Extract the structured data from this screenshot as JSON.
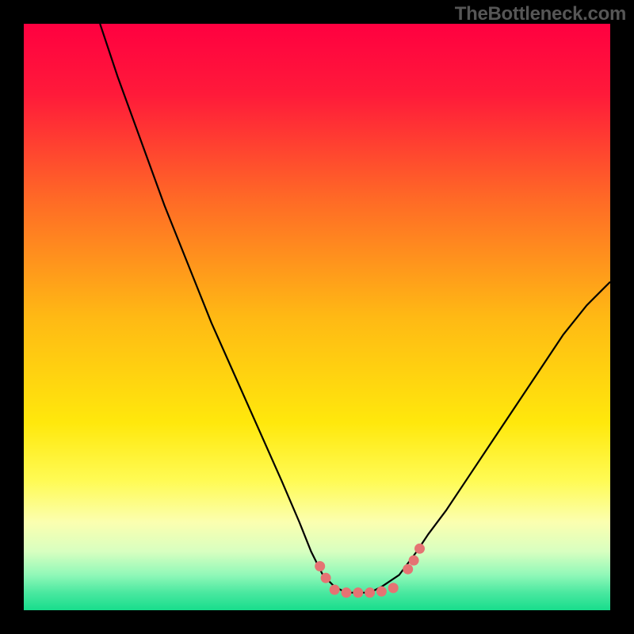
{
  "watermark": "TheBottleneck.com",
  "chart_data": {
    "type": "line",
    "title": "",
    "xlabel": "",
    "ylabel": "",
    "xlim": [
      0,
      100
    ],
    "ylim": [
      0,
      100
    ],
    "gradient_stops": [
      {
        "pos": 0.0,
        "color": "#ff0040"
      },
      {
        "pos": 0.12,
        "color": "#ff1a3a"
      },
      {
        "pos": 0.3,
        "color": "#ff6a26"
      },
      {
        "pos": 0.5,
        "color": "#ffb914"
      },
      {
        "pos": 0.68,
        "color": "#ffe80c"
      },
      {
        "pos": 0.78,
        "color": "#fffb55"
      },
      {
        "pos": 0.85,
        "color": "#fbffb0"
      },
      {
        "pos": 0.9,
        "color": "#d8ffc0"
      },
      {
        "pos": 0.94,
        "color": "#90f8b8"
      },
      {
        "pos": 0.97,
        "color": "#4ae8a0"
      },
      {
        "pos": 1.0,
        "color": "#18dd8c"
      }
    ],
    "series": [
      {
        "name": "bottleneck-curve",
        "x": [
          13,
          16,
          20,
          24,
          28,
          32,
          36,
          40,
          44,
          47,
          49,
          51,
          53,
          55,
          57,
          59,
          61,
          64,
          67,
          69,
          72,
          76,
          80,
          84,
          88,
          92,
          96,
          100
        ],
        "y": [
          100,
          91,
          80,
          69,
          59,
          49,
          40,
          31,
          22,
          15,
          10,
          6,
          4,
          3,
          3,
          3,
          4,
          6,
          10,
          13,
          17,
          23,
          29,
          35,
          41,
          47,
          52,
          56
        ]
      }
    ],
    "markers": {
      "color": "#e57373",
      "points": [
        {
          "x": 50.5,
          "y": 7.5
        },
        {
          "x": 51.5,
          "y": 5.5
        },
        {
          "x": 53.0,
          "y": 3.5
        },
        {
          "x": 55.0,
          "y": 3.0
        },
        {
          "x": 57.0,
          "y": 3.0
        },
        {
          "x": 59.0,
          "y": 3.0
        },
        {
          "x": 61.0,
          "y": 3.2
        },
        {
          "x": 63.0,
          "y": 3.8
        },
        {
          "x": 65.5,
          "y": 7.0
        },
        {
          "x": 66.5,
          "y": 8.5
        },
        {
          "x": 67.5,
          "y": 10.5
        }
      ]
    }
  }
}
